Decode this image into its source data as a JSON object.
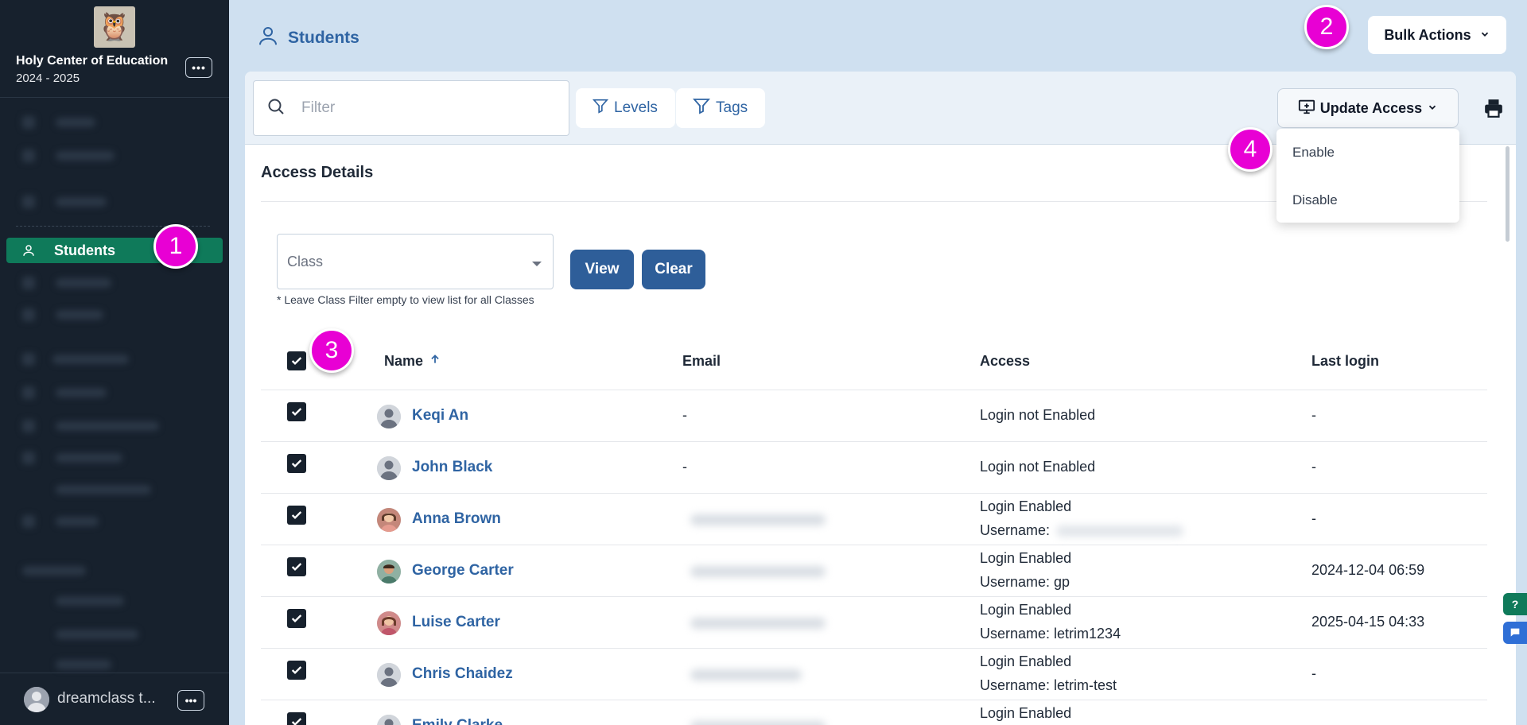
{
  "sidebar": {
    "school_name": "Holy Center of Education",
    "school_year": "2024 - 2025",
    "more": "•••",
    "active_item": "Students",
    "user_name": "dreamclass t...",
    "user_more": "•••"
  },
  "header": {
    "title": "Students",
    "bulk_actions": "Bulk Actions"
  },
  "toolbar": {
    "filter_placeholder": "Filter",
    "levels": "Levels",
    "tags": "Tags",
    "update_access": "Update Access"
  },
  "dropdown": {
    "items": [
      "Enable",
      "Disable"
    ]
  },
  "access_details": {
    "title": "Access Details",
    "class_placeholder": "Class",
    "hint": "* Leave Class Filter empty to view list for all Classes",
    "view": "View",
    "clear": "Clear"
  },
  "table": {
    "columns": [
      "Name",
      "Email",
      "Access",
      "Last login"
    ],
    "rows": [
      {
        "name": "Keqi An",
        "email": "-",
        "access": "Login not Enabled",
        "username": "",
        "last_login": "-"
      },
      {
        "name": "John Black",
        "email": "-",
        "access": "Login not Enabled",
        "username": "",
        "last_login": "-"
      },
      {
        "name": "Anna Brown",
        "email": "",
        "access": "Login Enabled",
        "username": "Username:",
        "last_login": "-"
      },
      {
        "name": "George Carter",
        "email": "",
        "access": "Login Enabled",
        "username": "Username: gp",
        "last_login": "2024-12-04 06:59"
      },
      {
        "name": "Luise Carter",
        "email": "",
        "access": "Login Enabled",
        "username": "Username: letrim1234",
        "last_login": "2025-04-15 04:33"
      },
      {
        "name": "Chris Chaidez",
        "email": "",
        "access": "Login Enabled",
        "username": "Username: letrim-test",
        "last_login": "-"
      },
      {
        "name": "Emily Clarke",
        "email": "",
        "access": "Login Enabled",
        "username": "",
        "last_login": ""
      }
    ]
  },
  "markers": [
    "1",
    "2",
    "3",
    "4"
  ],
  "widgets": {
    "help": "?"
  },
  "colors": {
    "sidebar_bg": "#17212d",
    "active_nav": "#0f7a5a",
    "primary": "#2e5e99",
    "link": "#2f64a3",
    "marker": "#e800d4"
  }
}
